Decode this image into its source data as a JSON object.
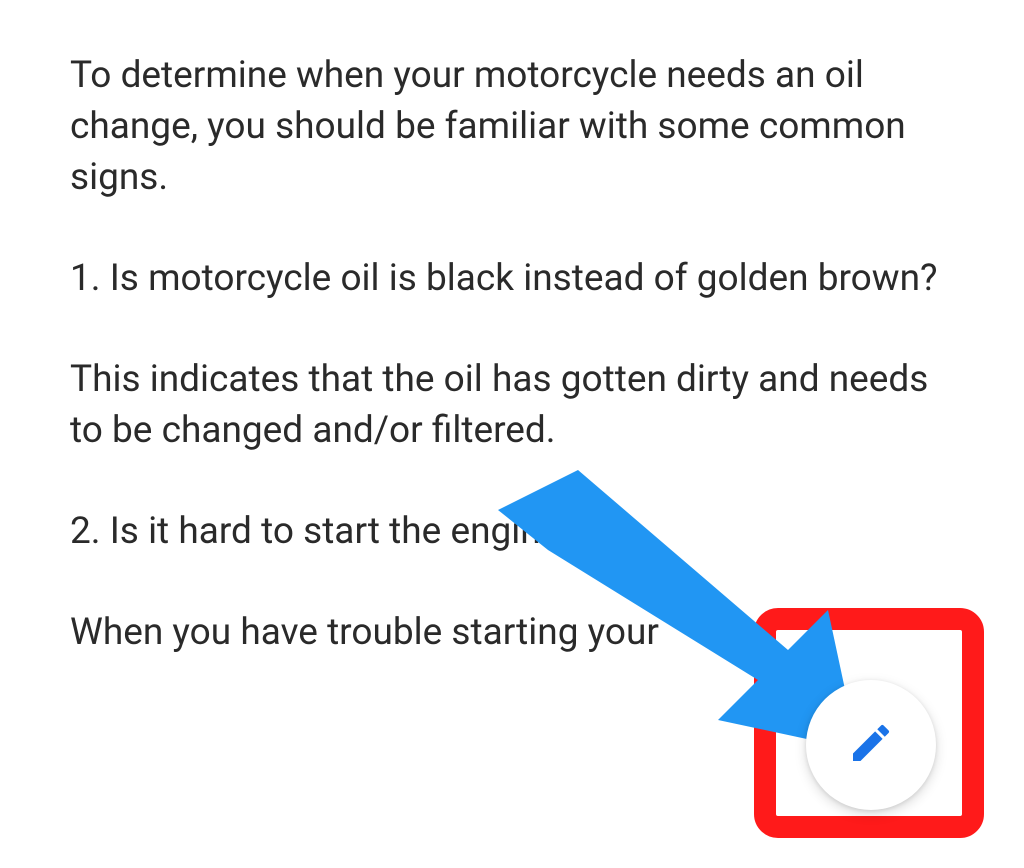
{
  "article": {
    "intro": "To determine when your motorcycle needs an oil change, you should be familiar with some common signs.",
    "q1": "1. Is motorcycle oil is black instead of golden brown?",
    "a1": "This indicates that the oil has gotten dirty and needs to be changed and/or filtered.",
    "q2": "2. Is it hard to start the engine?",
    "a2": "When you have trouble starting your"
  },
  "fab": {
    "label": "Edit"
  },
  "colors": {
    "highlight": "#ff1a1a",
    "arrow": "#2196f3",
    "pencil": "#1a73e8"
  }
}
